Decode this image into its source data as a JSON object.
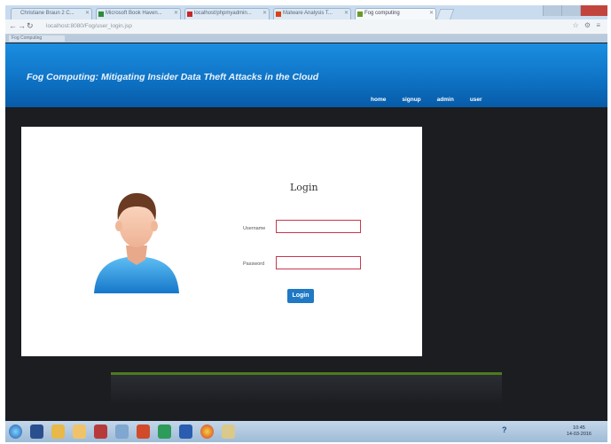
{
  "browser": {
    "tabs": [
      {
        "label": "Christiane Braun 2 C...",
        "favicon_color": "#e0e6ee"
      },
      {
        "label": "Microsoft Book Haven...",
        "favicon_color": "#2e8b3a"
      },
      {
        "label": "localhost/phpmyadmin...",
        "favicon_color": "#c62828"
      },
      {
        "label": "Malware Analysis T...",
        "favicon_color": "#d84315"
      },
      {
        "label": "Fog computing",
        "favicon_color": "#6a9b2a"
      }
    ],
    "url": "localhost:8080/Fog/user_login.jsp",
    "bookmark": "Fog Computing"
  },
  "site": {
    "title": "Fog Computing: Mitigating Insider Data Theft Attacks in the Cloud",
    "menu": [
      "home",
      "signup",
      "admin",
      "user"
    ]
  },
  "login": {
    "title": "Login",
    "username_label": "Username",
    "password_label": "Password",
    "button": "Login"
  },
  "taskbar": {
    "time": "10:45",
    "date": "14-03-2016"
  },
  "colors": {
    "header": "#0f74c6",
    "page_bg": "#1b1d21",
    "field_border": "#c8384c",
    "button": "#1f79c4",
    "accent_line": "#4d7a1d"
  }
}
